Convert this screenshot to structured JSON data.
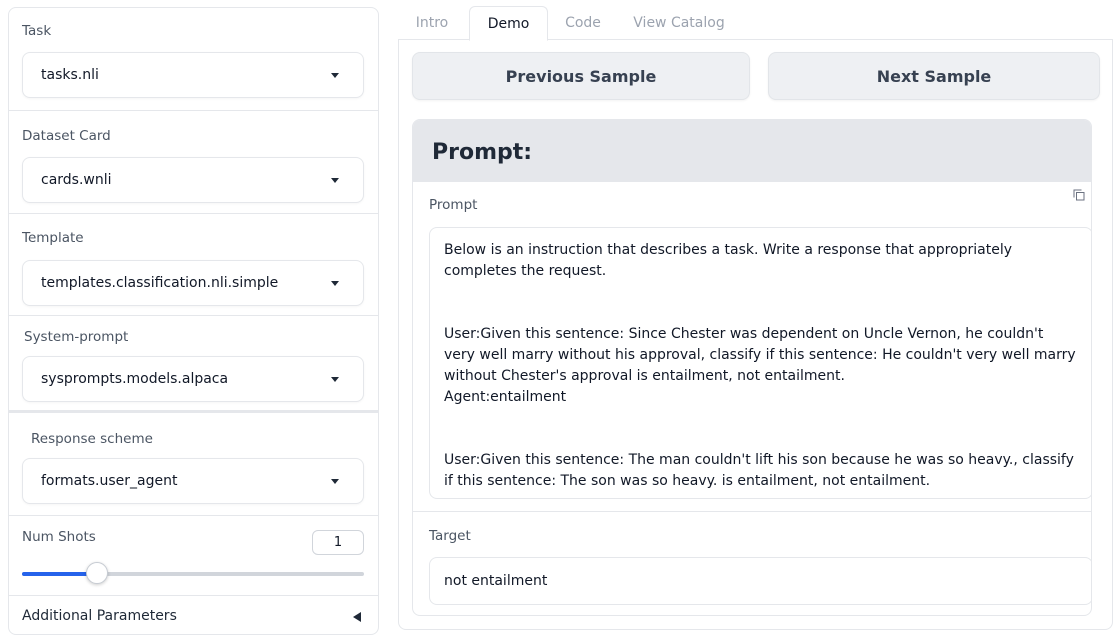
{
  "sidebar": {
    "task": {
      "label": "Task",
      "value": "tasks.nli"
    },
    "dataset_card": {
      "label": "Dataset Card",
      "value": "cards.wnli"
    },
    "template": {
      "label": "Template",
      "value": "templates.classification.nli.simple"
    },
    "system_prompt": {
      "label": "System-prompt",
      "value": "sysprompts.models.alpaca"
    },
    "response_scheme": {
      "label": "Response scheme",
      "value": "formats.user_agent"
    },
    "num_shots": {
      "label": "Num Shots",
      "value": "1",
      "slider_fraction": 0.22
    },
    "additional_parameters": {
      "label": "Additional Parameters"
    }
  },
  "tabs": [
    {
      "label": "Intro"
    },
    {
      "label": "Demo"
    },
    {
      "label": "Code"
    },
    {
      "label": "View Catalog"
    }
  ],
  "active_tab": "Demo",
  "buttons": {
    "previous": "Previous Sample",
    "next": "Next Sample"
  },
  "prompt_section": {
    "heading": "Prompt:",
    "field_label": "Prompt",
    "text": "Below is an instruction that describes a task. Write a response that appropriately completes the request.\n\n\nUser:Given this sentence: Since Chester was dependent on Uncle Vernon, he couldn't very well marry without his approval, classify if this sentence: He couldn't very well marry without Chester's approval is entailment, not entailment.\nAgent:entailment\n\n\nUser:Given this sentence: The man couldn't lift his son because he was so heavy., classify if this sentence: The son was so heavy. is entailment, not entailment."
  },
  "target_section": {
    "label": "Target",
    "value": "not entailment"
  },
  "colors": {
    "accent": "#2563eb",
    "header_bg": "#e5e7eb",
    "button_bg": "#eef0f3"
  }
}
